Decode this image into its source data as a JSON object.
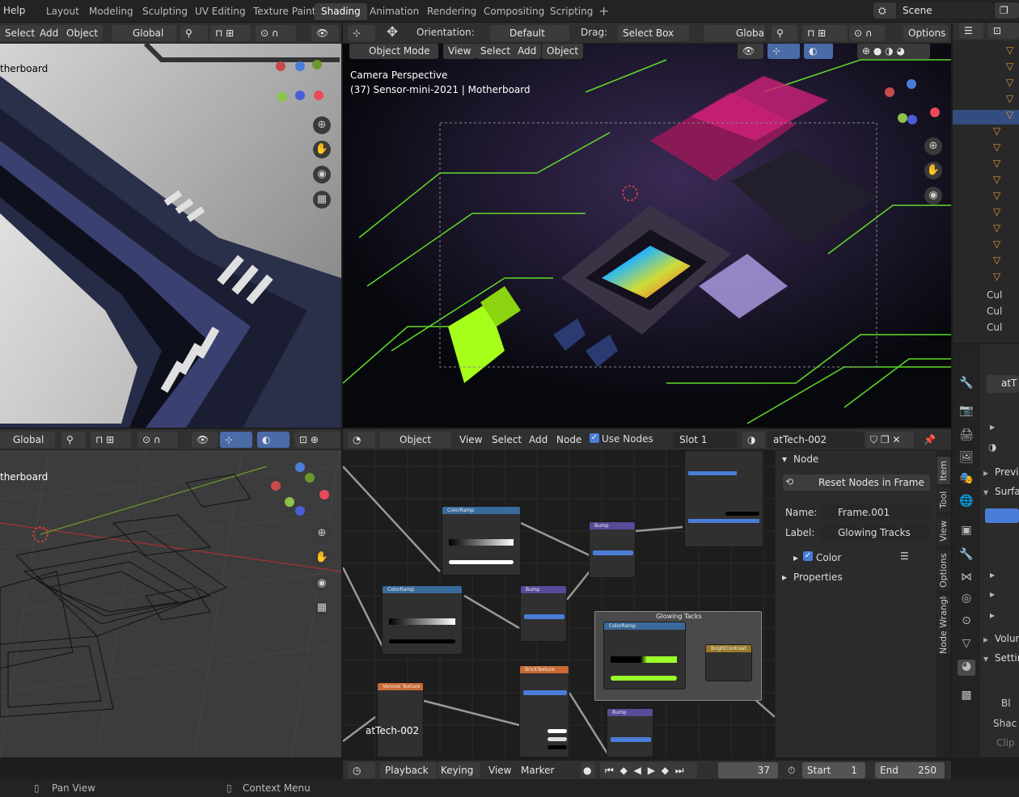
{
  "menu": {
    "help": "Help"
  },
  "workspace_tabs": [
    "Layout",
    "Modeling",
    "Sculpting",
    "UV Editing",
    "Texture Paint",
    "Shading",
    "Animation",
    "Rendering",
    "Compositing",
    "Scripting"
  ],
  "active_tab": "Shading",
  "scene": {
    "label": "Scene"
  },
  "left_viewport_header": {
    "select": "Select",
    "add": "Add",
    "object": "Object",
    "orientation": "Global"
  },
  "left_viewport": {
    "object_label": "therboard"
  },
  "main_viewport_header": {
    "orientation_label": "Orientation:",
    "orientation_value": "Default",
    "drag_label": "Drag:",
    "drag_value": "Select Box",
    "transform": "Global",
    "options": "Options"
  },
  "main_viewport_header2": {
    "mode": "Object Mode",
    "view": "View",
    "select": "Select",
    "add": "Add",
    "object": "Object"
  },
  "main_viewport": {
    "line1": "Camera Perspective",
    "line2": "(37) Sensor-mini-2021 | Motherboard"
  },
  "wire_viewport_header": {
    "orientation": "Global"
  },
  "wire_viewport": {
    "object_label": "therboard"
  },
  "node_editor_header": {
    "object": "Object",
    "view": "View",
    "select": "Select",
    "add": "Add",
    "node": "Node",
    "use_nodes": "Use Nodes",
    "slot": "Slot 1",
    "material": "atTech-002"
  },
  "node_editor": {
    "material_label": "atTech-002",
    "frame_label": "Glowing Tacks"
  },
  "node_panel": {
    "title": "Node",
    "reset_button": "Reset Nodes in Frame",
    "name_label": "Name:",
    "name_value": "Frame.001",
    "label_label": "Label:",
    "label_value": "Glowing Tracks",
    "color_label": "Color",
    "properties_label": "Properties",
    "side_tabs": [
      "Item",
      "Tool",
      "View",
      "Options",
      "Node Wrangler"
    ]
  },
  "nodes": [
    {
      "title": "ColorRamp"
    },
    {
      "title": "ColorRamp"
    },
    {
      "title": "Bump"
    },
    {
      "title": "Bump"
    },
    {
      "title": "Voronoi Texture"
    },
    {
      "title": "BrickTexture"
    },
    {
      "title": "Bump"
    },
    {
      "title": "ColorRamp"
    },
    {
      "title": "BrightContrast"
    }
  ],
  "timeline": {
    "playback": "Playback",
    "keying": "Keying",
    "view": "View",
    "marker": "Marker",
    "frame": "37",
    "start_label": "Start",
    "start": "1",
    "end_label": "End",
    "end": "250"
  },
  "outliner": {
    "rows": [
      "Cul",
      "Cul",
      "Cul"
    ]
  },
  "properties_panel": {
    "material_short": "atT",
    "items": [
      "Previ",
      "Surfa",
      "Volur",
      "Settin",
      "Bl",
      "Shac",
      "Clip"
    ]
  },
  "status": {
    "pan": "Pan View",
    "context": "Context Menu"
  }
}
